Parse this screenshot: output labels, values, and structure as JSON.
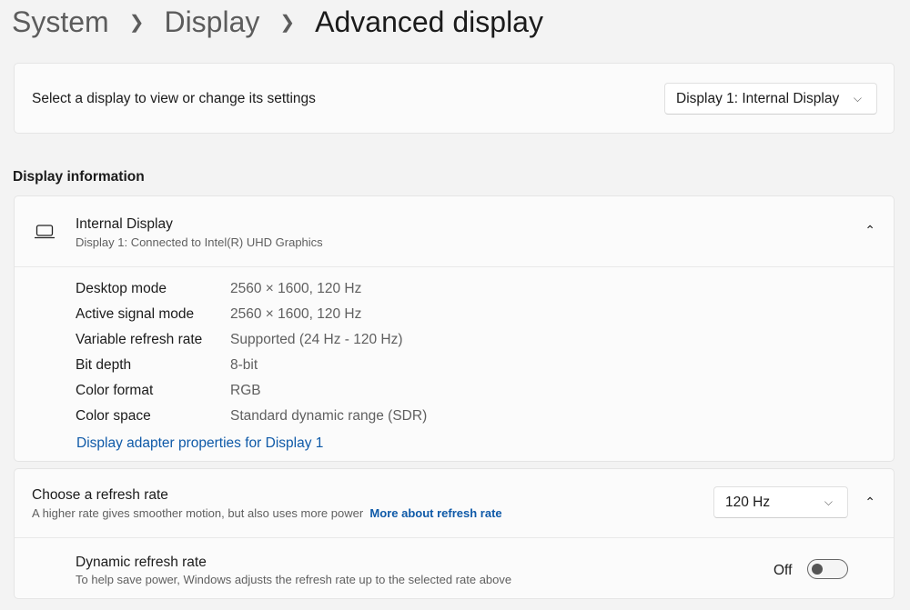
{
  "breadcrumb": [
    "System",
    "Display",
    "Advanced display"
  ],
  "select_display": {
    "label": "Select a display to view or change its settings",
    "value": "Display 1: Internal Display"
  },
  "section_title": "Display information",
  "display": {
    "name": "Internal Display",
    "subtitle": "Display 1: Connected to Intel(R) UHD Graphics",
    "rows": [
      {
        "label": "Desktop mode",
        "value": "2560 × 1600, 120 Hz"
      },
      {
        "label": "Active signal mode",
        "value": "2560 × 1600, 120 Hz"
      },
      {
        "label": "Variable refresh rate",
        "value": "Supported (24 Hz - 120 Hz)"
      },
      {
        "label": "Bit depth",
        "value": "8-bit"
      },
      {
        "label": "Color format",
        "value": "RGB"
      },
      {
        "label": "Color space",
        "value": "Standard dynamic range (SDR)"
      }
    ],
    "adapter_link": "Display adapter properties for Display 1"
  },
  "refresh": {
    "title": "Choose a refresh rate",
    "desc": "A higher rate gives smoother motion, but also uses more power",
    "link": "More about refresh rate",
    "value": "120 Hz"
  },
  "dynamic": {
    "title": "Dynamic refresh rate",
    "desc": "To help save power, Windows adjusts the refresh rate up to the selected rate above",
    "state": "Off"
  }
}
